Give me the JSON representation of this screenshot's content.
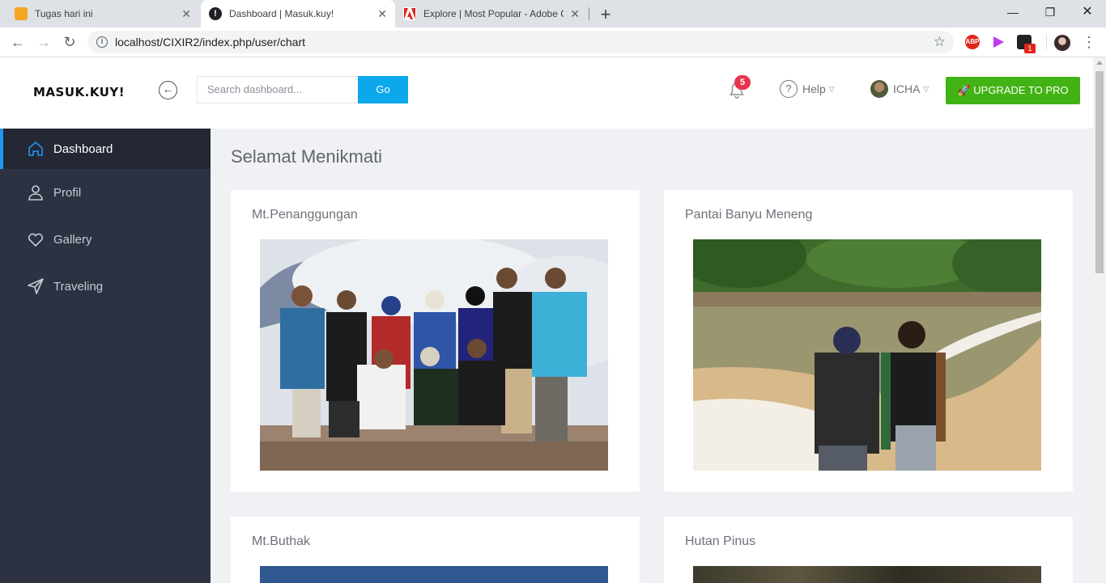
{
  "browser": {
    "tabs": [
      {
        "title": "Tugas hari ini",
        "active": false
      },
      {
        "title": "Dashboard | Masuk.kuy!",
        "active": true
      },
      {
        "title": "Explore | Most Popular - Adobe C",
        "active": false
      }
    ],
    "url": "localhost/CIXIR2/index.php/user/chart",
    "extensions": {
      "abp": "ABP",
      "badge_count": "1"
    }
  },
  "header": {
    "logo": "MASUK.KUY!",
    "search_placeholder": "Search dashboard...",
    "search_button": "Go",
    "notification_count": "5",
    "help_label": "Help",
    "user_name": "ICHA",
    "upgrade_label": "UPGRADE TO PRO",
    "accent": "#0ca7ec",
    "upgrade_color": "#41b314"
  },
  "sidebar": {
    "items": [
      {
        "label": "Dashboard",
        "icon": "home-icon",
        "active": true
      },
      {
        "label": "Profil",
        "icon": "user-icon",
        "active": false
      },
      {
        "label": "Gallery",
        "icon": "heart-icon",
        "active": false
      },
      {
        "label": "Traveling",
        "icon": "send-icon",
        "active": false
      }
    ]
  },
  "main": {
    "title": "Selamat Menikmati",
    "cards": [
      {
        "title": "Mt.Penanggungan"
      },
      {
        "title": "Pantai Banyu Meneng"
      },
      {
        "title": "Mt.Buthak"
      },
      {
        "title": "Hutan Pinus"
      }
    ]
  }
}
